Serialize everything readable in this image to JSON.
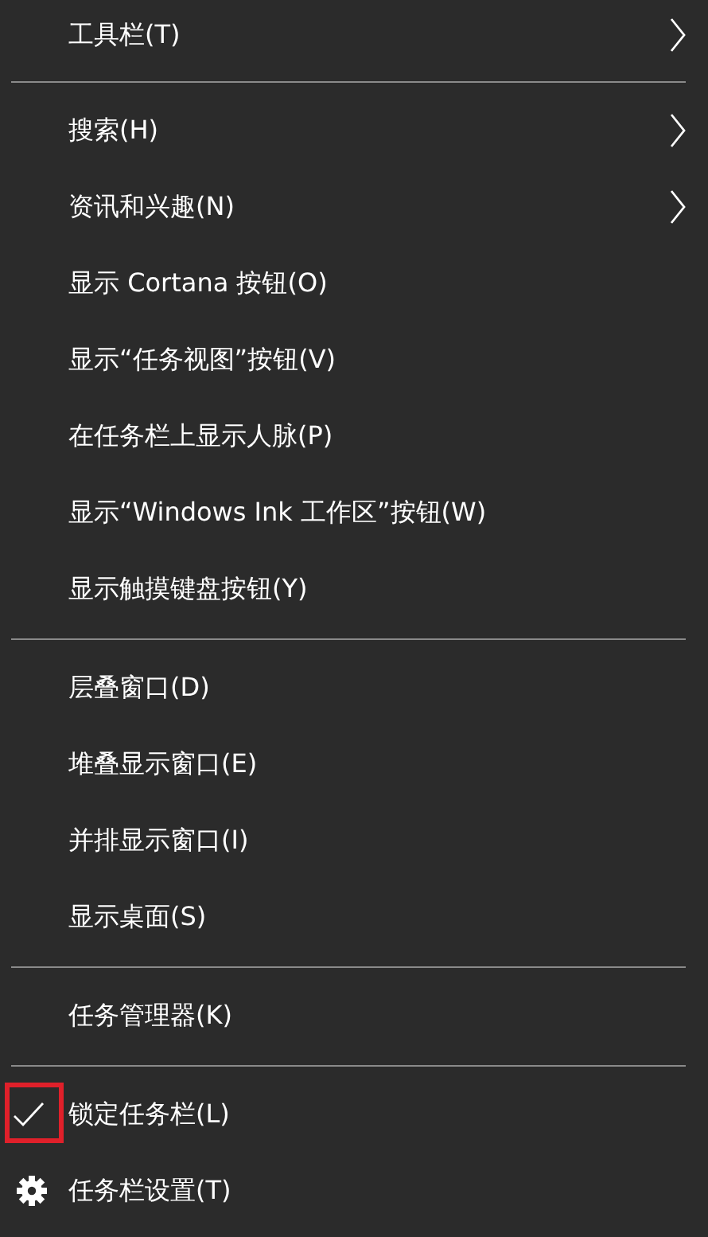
{
  "sections": [
    {
      "items": [
        {
          "label": "工具栏(T)",
          "kind": "submenu"
        }
      ]
    },
    {
      "items": [
        {
          "label": "搜索(H)",
          "kind": "submenu"
        },
        {
          "label": "资讯和兴趣(N)",
          "kind": "submenu"
        },
        {
          "label": "显示 Cortana 按钮(O)",
          "kind": "plain"
        },
        {
          "label": "显示“任务视图”按钮(V)",
          "kind": "plain"
        },
        {
          "label": "在任务栏上显示人脉(P)",
          "kind": "plain"
        },
        {
          "label": "显示“Windows Ink 工作区”按钮(W)",
          "kind": "plain"
        },
        {
          "label": "显示触摸键盘按钮(Y)",
          "kind": "plain"
        }
      ]
    },
    {
      "items": [
        {
          "label": "层叠窗口(D)",
          "kind": "plain"
        },
        {
          "label": "堆叠显示窗口(E)",
          "kind": "plain"
        },
        {
          "label": "并排显示窗口(I)",
          "kind": "plain"
        },
        {
          "label": "显示桌面(S)",
          "kind": "plain"
        }
      ]
    },
    {
      "items": [
        {
          "label": "任务管理器(K)",
          "kind": "plain"
        }
      ]
    },
    {
      "items": [
        {
          "label": "锁定任务栏(L)",
          "kind": "check",
          "checked": true,
          "annotated": true
        },
        {
          "label": "任务栏设置(T)",
          "kind": "settings"
        }
      ]
    }
  ]
}
